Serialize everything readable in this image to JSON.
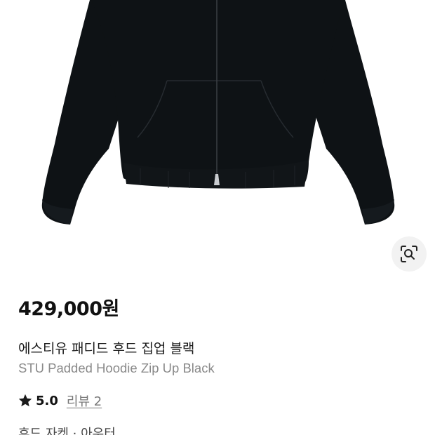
{
  "product": {
    "image_alt": "STU Padded Hoodie Zip Up Black",
    "price": "429,000원",
    "title_ko": "에스티유 패디드 후드 집업 블랙",
    "title_en": "STU Padded Hoodie Zip Up Black",
    "rating": "5.0",
    "review_link": "리뷰 2",
    "category": "후드 자켓 · 아우터"
  },
  "icons": {
    "lens": "lens-search-icon",
    "star": "star-icon"
  },
  "colors": {
    "garment": "#0e1215",
    "star": "#1a1a1a",
    "muted_text": "#8a8a8a",
    "lens_bg": "#f2f2f2"
  }
}
